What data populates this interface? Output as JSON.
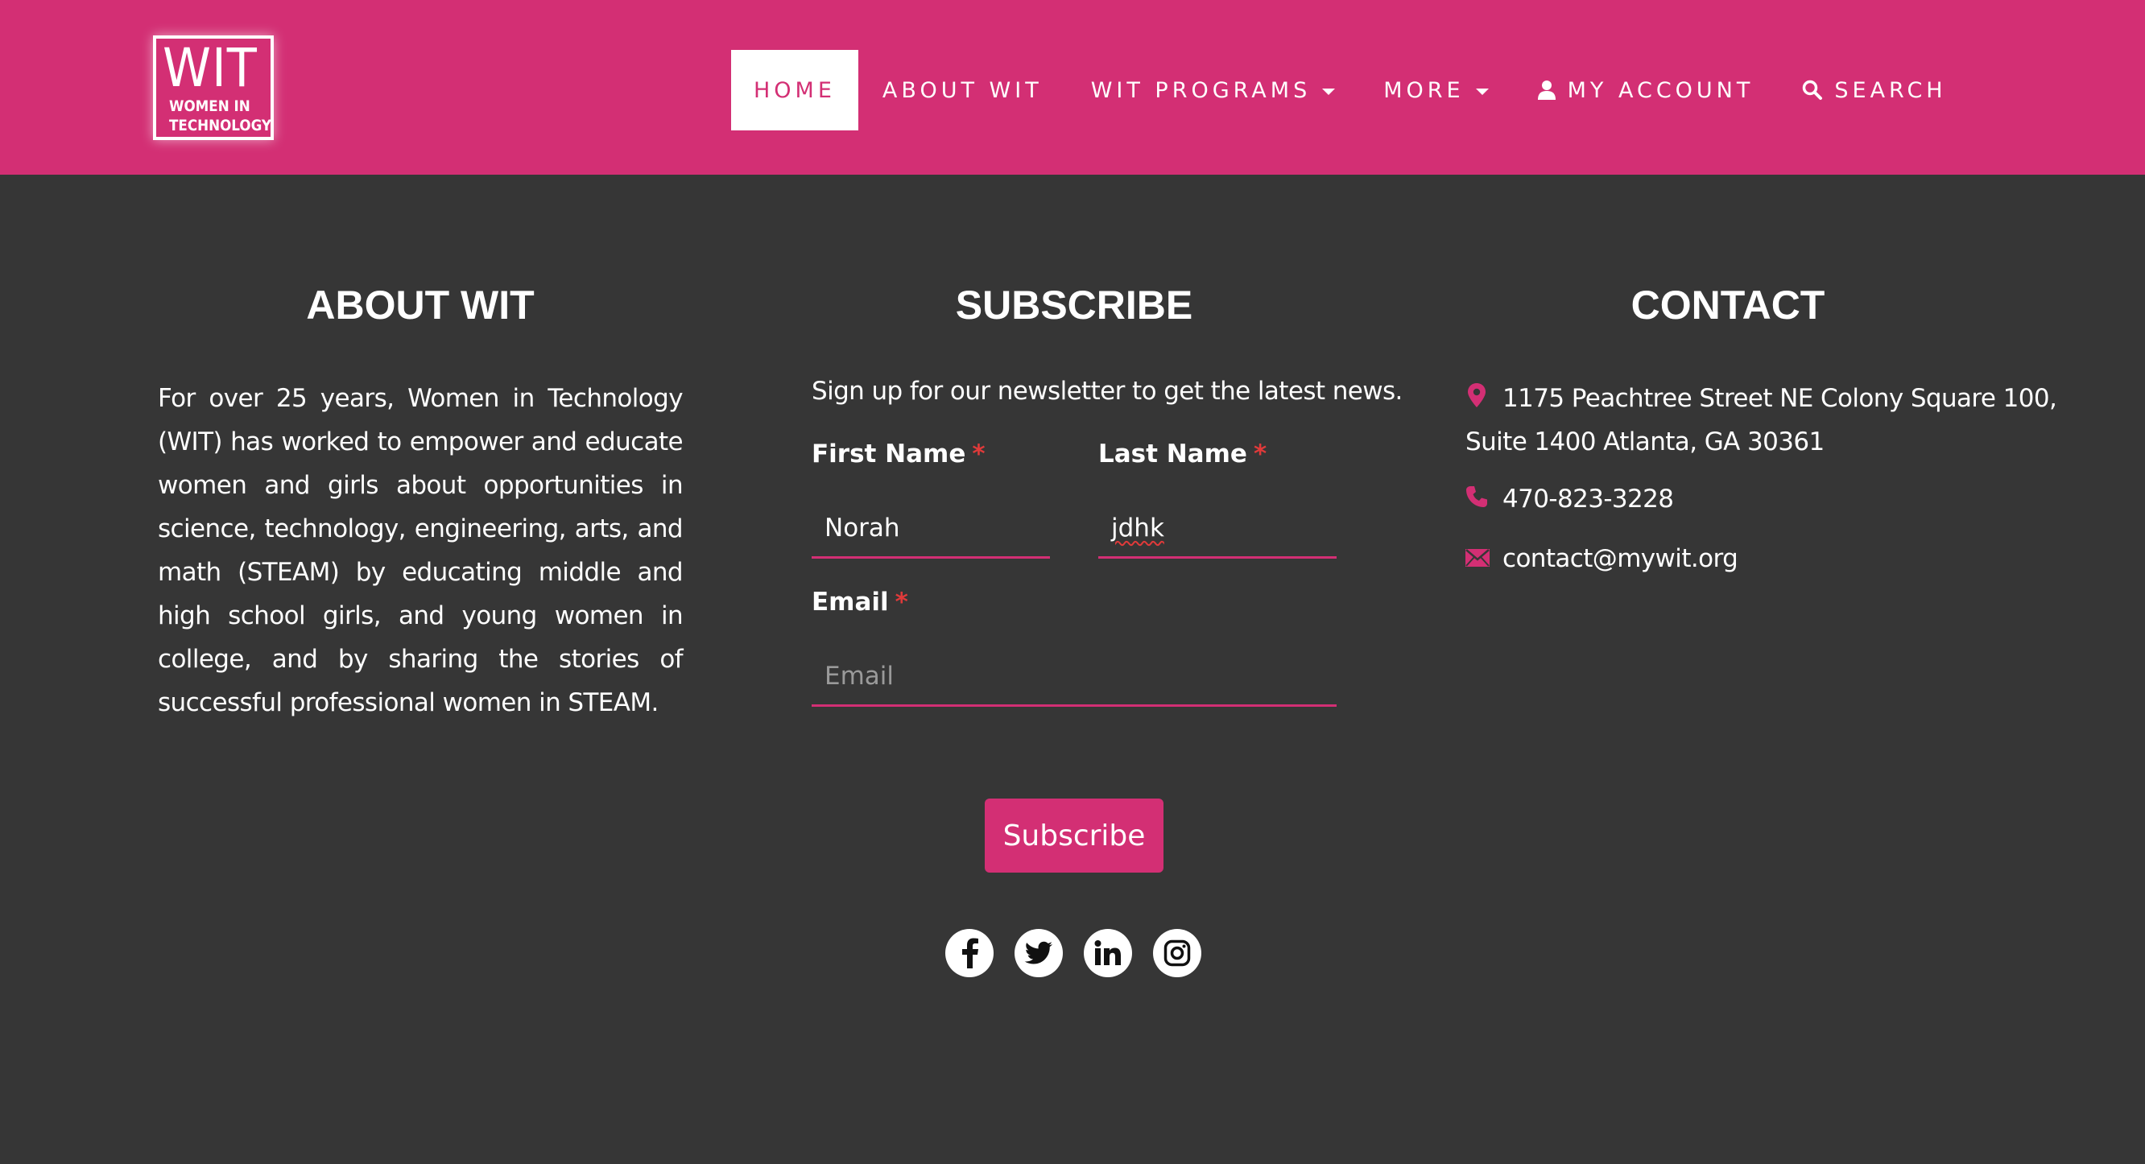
{
  "header": {
    "logo": {
      "title": "WIT",
      "subtitle_line1": "WOMEN IN",
      "subtitle_line2": "TECHNOLOGY"
    },
    "nav": [
      {
        "label": "HOME",
        "active": true
      },
      {
        "label": "ABOUT WIT"
      },
      {
        "label": "WIT PROGRAMS",
        "dropdown": true
      },
      {
        "label": "MORE",
        "dropdown": true
      },
      {
        "label": "MY ACCOUNT",
        "icon": "user-icon"
      },
      {
        "label": "SEARCH",
        "icon": "search-icon"
      }
    ]
  },
  "about": {
    "title": "ABOUT WIT",
    "text": "For over 25 years, Women in Technology (WIT) has worked to empower and educate women and girls about opportunities in science, technology, engineering, arts, and math (STEAM) by educating middle and high school girls, and young women in college, and by sharing the stories of successful professional women in STEAM."
  },
  "subscribe": {
    "title": "SUBSCRIBE",
    "intro": "Sign up for our newsletter to get the latest news.",
    "first_name_label": "First Name",
    "first_name_value": "Norah",
    "last_name_label": "Last Name",
    "last_name_value": "jdhk",
    "email_label": "Email",
    "email_placeholder": "Email",
    "required_mark": "*",
    "button_label": "Subscribe",
    "social": [
      "facebook-icon",
      "twitter-icon",
      "linkedin-icon",
      "instagram-icon"
    ]
  },
  "contact": {
    "title": "CONTACT",
    "address_line1": "1175 Peachtree Street NE Colony Square 100,",
    "address_line2": "Suite 1400 Atlanta, GA 30361",
    "phone": "470-823-3228",
    "email": "contact@mywit.org"
  },
  "colors": {
    "brand": "#d32f74",
    "background": "#363636",
    "required": "#e03a3a"
  }
}
